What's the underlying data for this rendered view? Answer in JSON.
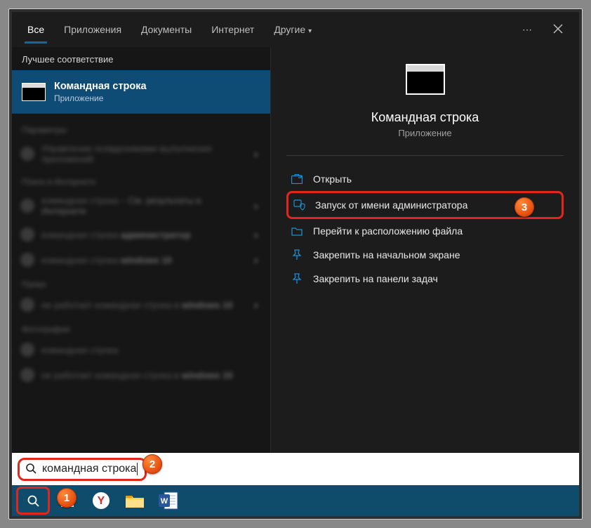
{
  "tabs": {
    "all": "Все",
    "apps": "Приложения",
    "documents": "Документы",
    "internet": "Интернет",
    "other": "Другие"
  },
  "left": {
    "best_match_header": "Лучшее соответствие",
    "best_match": {
      "title": "Командная строка",
      "subtitle": "Приложение"
    },
    "obscured": {
      "sec1": "Параметры",
      "r1": "Управление псевдонимами выполнения приложений",
      "sec2": "Поиск в Интернете",
      "r2a": "командная строка",
      "r2b": "См. результаты в Интернете",
      "r3a": "командная строка",
      "r3b": "администратор",
      "r4a": "командная строка",
      "r4b": "windows 10",
      "sec3": "Папки",
      "r5a": "не работает командная строка в",
      "r5b": "windows 10",
      "sec4": "Фотографии",
      "r6": "командная строка",
      "r7a": "не работает командная строка в",
      "r7b": "windows 10"
    }
  },
  "right": {
    "title": "Командная строка",
    "subtitle": "Приложение",
    "actions": {
      "open": "Открыть",
      "run_admin": "Запуск от имени администратора",
      "open_location": "Перейти к расположению файла",
      "pin_start": "Закрепить на начальном экране",
      "pin_taskbar": "Закрепить на панели задач"
    }
  },
  "search": {
    "query": "командная строка"
  },
  "badges": {
    "b1": "1",
    "b2": "2",
    "b3": "3"
  }
}
